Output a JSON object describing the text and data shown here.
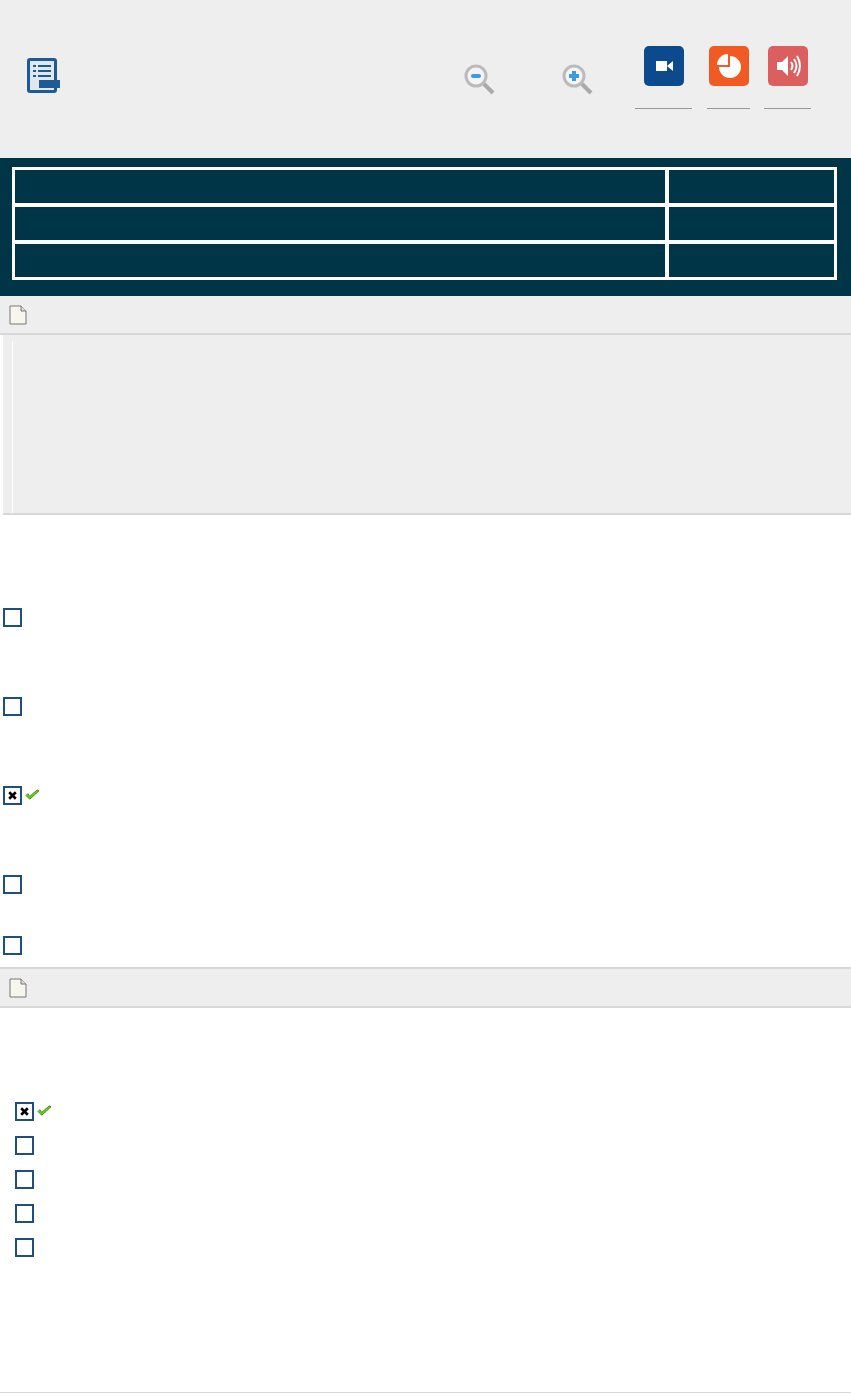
{
  "question_1": {
    "options": [
      {
        "checked": false,
        "correct": false
      },
      {
        "checked": false,
        "correct": false
      },
      {
        "checked": true,
        "correct": true
      },
      {
        "checked": false,
        "correct": false
      },
      {
        "checked": false,
        "correct": false
      }
    ]
  },
  "question_2": {
    "options": [
      {
        "checked": true,
        "correct": true
      },
      {
        "checked": false,
        "correct": false
      },
      {
        "checked": false,
        "correct": false
      },
      {
        "checked": false,
        "correct": false
      },
      {
        "checked": false,
        "correct": false
      }
    ]
  }
}
